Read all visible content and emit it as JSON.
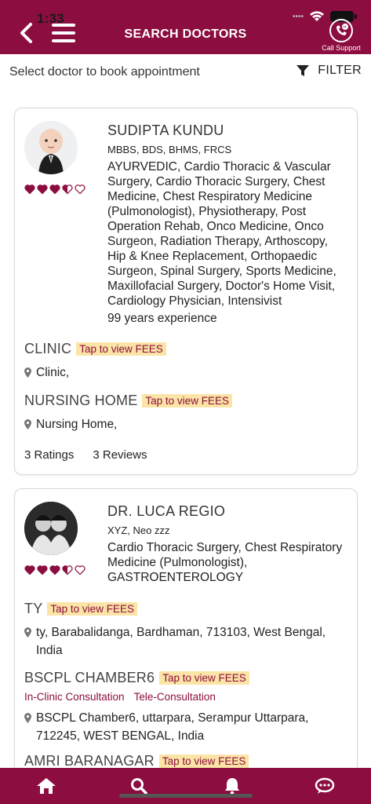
{
  "status": {
    "time": "1:33"
  },
  "header": {
    "title": "SEARCH DOCTORS",
    "call_support": "Call Support"
  },
  "subheader": {
    "text": "Select doctor to book appointment",
    "filter": "FILTER"
  },
  "doctors": [
    {
      "name": "SUDIPTA KUNDU",
      "degree": "MBBS, BDS, BHMS, FRCS",
      "specialities": "AYURVEDIC, Cardio Thoracic & Vascular Surgery, Cardio Thoracic Surgery, Chest Medicine, Chest Respiratory Medicine (Pulmonologist), Physiotherapy, Post Operation Rehab, Onco Medicine, Onco Surgeon, Radiation Therapy, Arthoscopy, Hip & Knee Replacement, Orthopaedic Surgeon, Spinal Surgery, Sports Medicine, Maxillofacial Surgery, Doctor's Home Visit, Cardiology Physician, Intensivist",
      "experience": "99 years experience",
      "rating_stars": 3.5,
      "locations": [
        {
          "name": "CLINIC",
          "fees": "Tap to view FEES",
          "address": "Clinic,"
        },
        {
          "name": "NURSING HOME",
          "fees": "Tap to view FEES",
          "address": "Nursing Home,"
        }
      ],
      "ratings": "3 Ratings",
      "reviews": "3 Reviews"
    },
    {
      "name": "DR.  LUCA REGIO",
      "degree": "XYZ, Neo zzz",
      "specialities": "Cardio Thoracic Surgery, Chest Respiratory Medicine (Pulmonologist), GASTROENTEROLOGY",
      "rating_stars": 3.5,
      "locations": [
        {
          "name": "TY",
          "fees": "Tap to view FEES",
          "address": "ty, Barabalidanga, Bardhaman, 713103, West Bengal, India"
        },
        {
          "name": "BSCPL CHAMBER6",
          "fees": "Tap to view FEES",
          "consult": [
            "In-Clinic Consultation",
            "Tele-Consultation"
          ],
          "address": "BSCPL Chamber6, uttarpara, Serampur Uttarpara, 712245, WEST BENGAL, India"
        },
        {
          "name": "AMRI BARANAGAR",
          "fees": "Tap to view FEES"
        }
      ]
    }
  ],
  "bottom_nav": [
    "home-icon",
    "search-icon",
    "bell-icon",
    "chat-icon"
  ],
  "colors": {
    "primary": "#8c0d3f",
    "fees_bg": "#fbe4a6",
    "heart": "#8c0d3f"
  }
}
